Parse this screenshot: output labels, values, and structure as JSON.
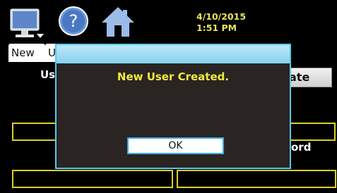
{
  "header": {
    "date": "4/10/2015",
    "time": "1:51 PM",
    "icons": [
      "monitor-icon",
      "help-icon",
      "home-icon"
    ]
  },
  "tabs": [
    {
      "label": "New"
    },
    {
      "label": "U"
    }
  ],
  "background": {
    "user_label": "Use",
    "right_button_label": "ate",
    "password_label": "ord"
  },
  "dialog": {
    "message": "New User Created.",
    "ok_label": "OK"
  },
  "colors": {
    "accent_yellow": "#e8e35a",
    "field_border": "#d9d222",
    "dialog_border": "#55c8ef"
  }
}
